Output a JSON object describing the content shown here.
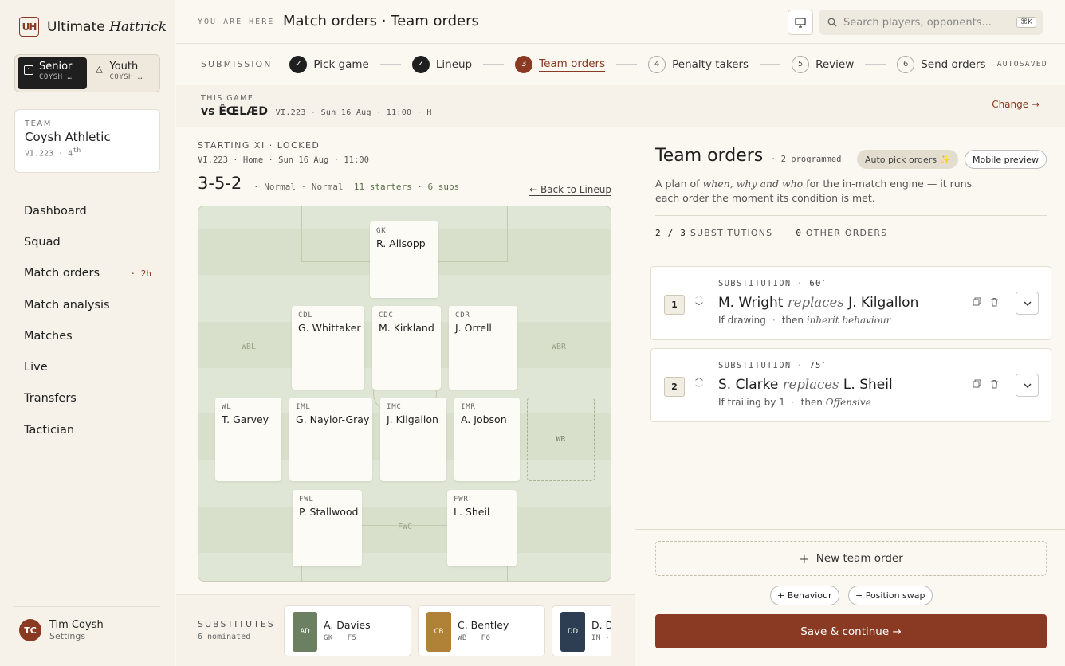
{
  "app": {
    "logo_mark": "UH",
    "name_plain": "Ultimate",
    "name_italic": "Hattrick"
  },
  "squad_switch": {
    "senior": {
      "label": "Senior",
      "sub": "COYSH …"
    },
    "youth": {
      "label": "Youth",
      "sub": "COYSH …"
    }
  },
  "team": {
    "label": "TEAM",
    "name": "Coysh Athletic",
    "league": "VI.223 · 4",
    "rank_suffix": "th"
  },
  "nav": [
    {
      "label": "Dashboard",
      "badge": ""
    },
    {
      "label": "Squad",
      "badge": ""
    },
    {
      "label": "Match orders",
      "badge": "· 2h"
    },
    {
      "label": "Match analysis",
      "badge": ""
    },
    {
      "label": "Matches",
      "badge": ""
    },
    {
      "label": "Live",
      "badge": ""
    },
    {
      "label": "Transfers",
      "badge": ""
    },
    {
      "label": "Tactician",
      "badge": ""
    }
  ],
  "user": {
    "initials": "TC",
    "name": "Tim Coysh",
    "link": "Settings"
  },
  "header": {
    "you_are_here": "YOU ARE HERE",
    "title": "Match orders · Team orders",
    "search_placeholder": "Search players, opponents...",
    "shortcut": "⌘K"
  },
  "stepper": {
    "label": "SUBMISSION",
    "steps": [
      {
        "num": "✓",
        "label": "Pick game",
        "state": "done"
      },
      {
        "num": "✓",
        "label": "Lineup",
        "state": "done"
      },
      {
        "num": "3",
        "label": "Team orders",
        "state": "current"
      },
      {
        "num": "4",
        "label": "Penalty takers",
        "state": "todo"
      },
      {
        "num": "5",
        "label": "Review",
        "state": "todo"
      },
      {
        "num": "6",
        "label": "Send orders",
        "state": "todo"
      }
    ],
    "autosaved": "AUTOSAVED"
  },
  "game": {
    "label": "THIS GAME",
    "opponent": "vs ÊŒLÆD",
    "meta": "VI.223 · Sun 16 Aug · 11:00 · H",
    "change": "Change →"
  },
  "lineup": {
    "label": "STARTING XI · LOCKED",
    "meta": "VI.223 · Home · Sun 16 Aug · 11:00",
    "formation": "3-5-2",
    "attitude": "· Normal · Normal",
    "starters": "11 starters · 6 subs",
    "back": "← Back to Lineup",
    "zones": {
      "wbl": "WBL",
      "wbr": "WBR",
      "fwc": "FWC",
      "wr": "WR"
    },
    "players": [
      {
        "pos": "GK",
        "name": "R. Allsopp"
      },
      {
        "pos": "CDL",
        "name": "G. Whittaker"
      },
      {
        "pos": "CDC",
        "name": "M. Kirkland"
      },
      {
        "pos": "CDR",
        "name": "J. Orrell"
      },
      {
        "pos": "WL",
        "name": "T. Garvey"
      },
      {
        "pos": "IML",
        "name": "G. Naylor-Gray"
      },
      {
        "pos": "IMC",
        "name": "J. Kilgallon"
      },
      {
        "pos": "IMR",
        "name": "A. Jobson"
      },
      {
        "pos": "FWL",
        "name": "P. Stallwood"
      },
      {
        "pos": "FWR",
        "name": "L. Sheil"
      }
    ]
  },
  "substitutes": {
    "label": "SUBSTITUTES",
    "count": "6 nominated",
    "items": [
      {
        "initials": "AD",
        "name": "A. Davies",
        "meta": "GK · F5",
        "color": "#6b8060"
      },
      {
        "initials": "CB",
        "name": "C. Bentley",
        "meta": "WB · F6",
        "color": "#b08238"
      },
      {
        "initials": "DD",
        "name": "D. D",
        "meta": "IM · ",
        "color": "#2d3d52"
      }
    ]
  },
  "orders": {
    "title": "Team orders",
    "programmed": "· 2 programmed",
    "auto_pick": "Auto pick orders ✨",
    "mobile_preview": "Mobile preview",
    "desc_pre": "A plan of ",
    "desc_em": "when, why and who",
    "desc_post": " for the in-match engine — it runs each order the moment its condition is met.",
    "subs_count": "2 / 3",
    "subs_label": "SUBSTITUTIONS",
    "other_count": "0",
    "other_label": "OTHER ORDERS",
    "items": [
      {
        "num": "1",
        "type": "SUBSTITUTION",
        "minute": "· 60′",
        "in": "M. Wright",
        "verb": "replaces",
        "out": "J. Kilgallon",
        "cond": "If drawing",
        "then": "then",
        "then_em": "inherit behaviour"
      },
      {
        "num": "2",
        "type": "SUBSTITUTION",
        "minute": "· 75′",
        "in": "S. Clarke",
        "verb": "replaces",
        "out": "L. Sheil",
        "cond": "If trailing by 1",
        "then": "then",
        "then_em": "Offensive"
      }
    ],
    "new_order": "New team order",
    "chip_behaviour": "+ Behaviour",
    "chip_swap": "+ Position swap",
    "save": "Save & continue →"
  },
  "colors": {
    "accent": "#8a3a22",
    "dark": "#1f1f1f",
    "pitch": "#e0e6d5"
  }
}
